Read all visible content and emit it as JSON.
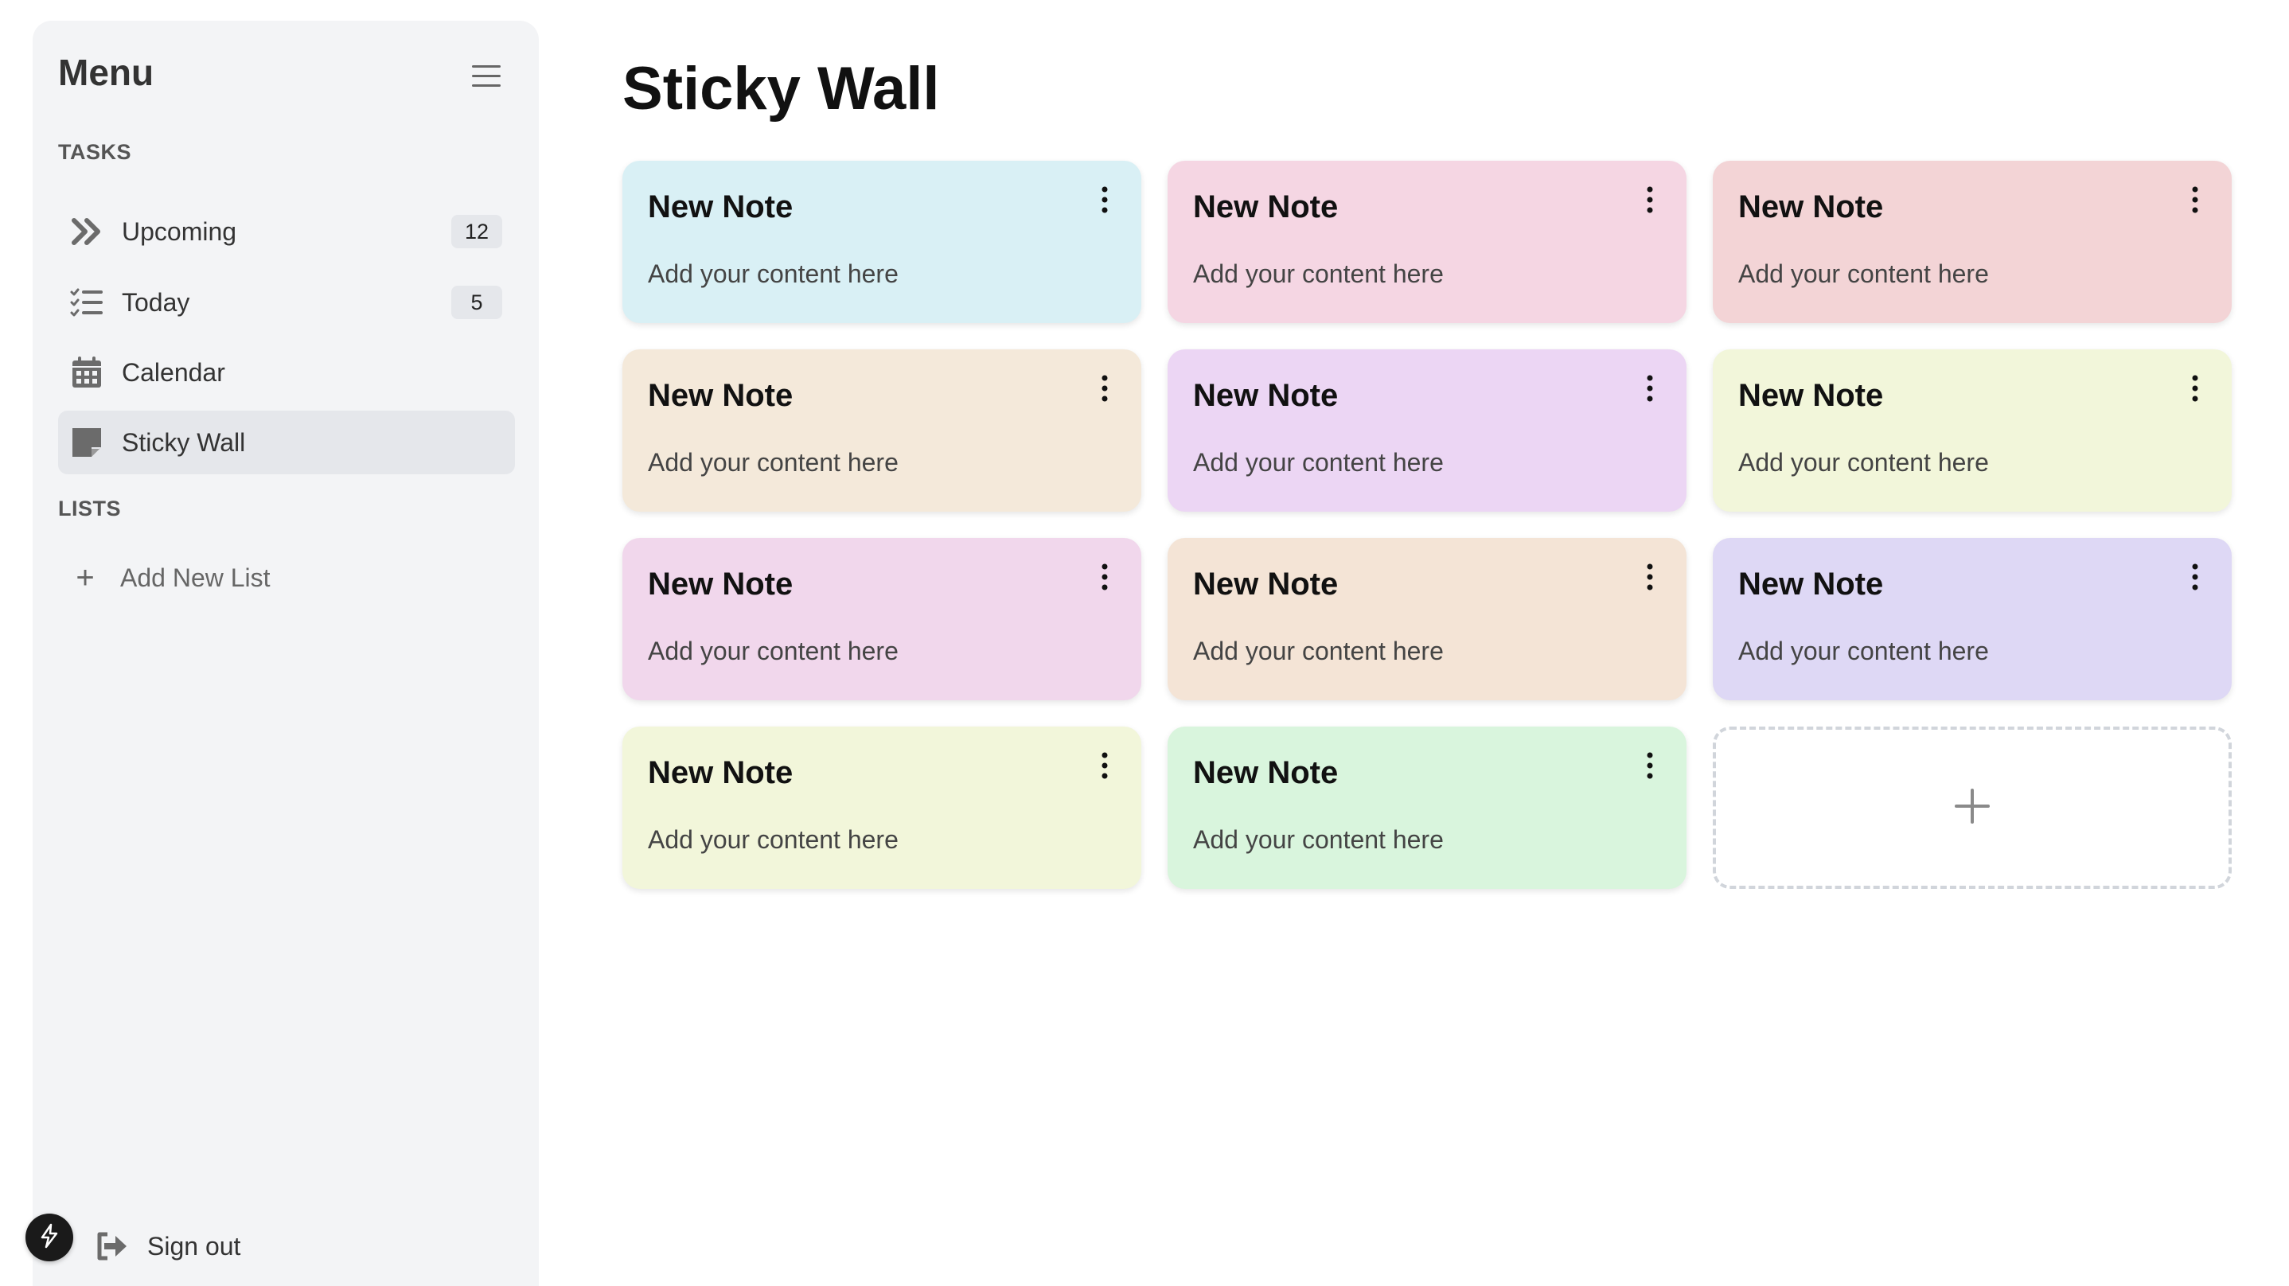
{
  "sidebar": {
    "title": "Menu",
    "tasks_label": "TASKS",
    "lists_label": "LISTS",
    "items": [
      {
        "label": "Upcoming",
        "badge": "12",
        "icon": "chevrons-right-icon"
      },
      {
        "label": "Today",
        "badge": "5",
        "icon": "checklist-icon"
      },
      {
        "label": "Calendar",
        "badge": null,
        "icon": "calendar-icon"
      },
      {
        "label": "Sticky Wall",
        "badge": null,
        "icon": "sticky-note-icon",
        "active": true
      }
    ],
    "add_list_label": "Add New List",
    "signout_label": "Sign out"
  },
  "main": {
    "title": "Sticky Wall",
    "notes": [
      {
        "title": "New Note",
        "body": "Add your content here",
        "color": "#d9f0f5"
      },
      {
        "title": "New Note",
        "body": "Add your content here",
        "color": "#f5d6e3"
      },
      {
        "title": "New Note",
        "body": "Add your content here",
        "color": "#f3d4d6"
      },
      {
        "title": "New Note",
        "body": "Add your content here",
        "color": "#f4e9da"
      },
      {
        "title": "New Note",
        "body": "Add your content here",
        "color": "#ecd6f4"
      },
      {
        "title": "New Note",
        "body": "Add your content here",
        "color": "#f2f6da"
      },
      {
        "title": "New Note",
        "body": "Add your content here",
        "color": "#f1d7ec"
      },
      {
        "title": "New Note",
        "body": "Add your content here",
        "color": "#f4e4d6"
      },
      {
        "title": "New Note",
        "body": "Add your content here",
        "color": "#ded8f5"
      },
      {
        "title": "New Note",
        "body": "Add your content here",
        "color": "#f2f6da"
      },
      {
        "title": "New Note",
        "body": "Add your content here",
        "color": "#d9f5dd"
      }
    ]
  },
  "colors": {
    "sidebar_bg": "#f3f4f6",
    "active_item_bg": "#e5e7eb",
    "icon_gray": "#6b6b6b"
  }
}
